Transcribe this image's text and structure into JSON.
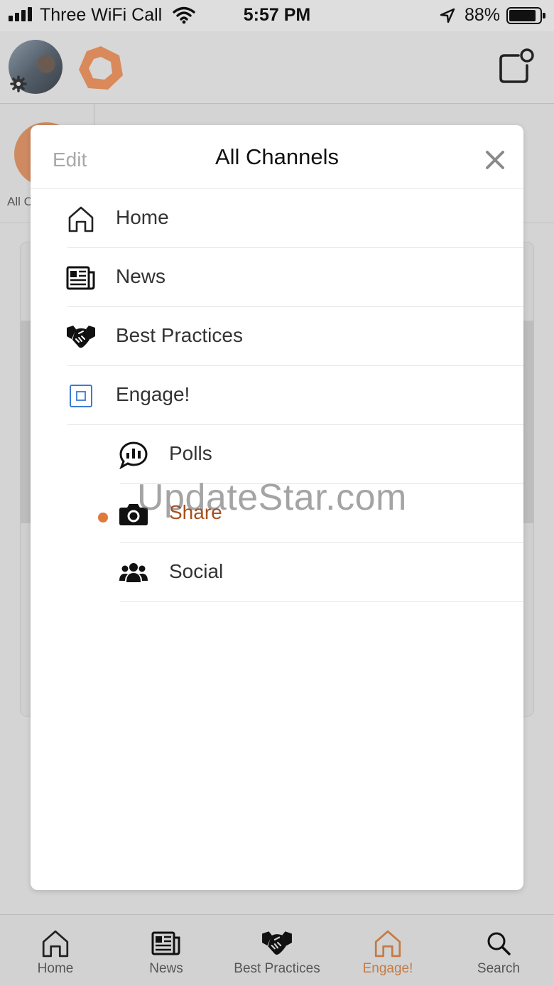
{
  "status_bar": {
    "carrier": "Three WiFi Call",
    "time": "5:57 PM",
    "battery_percent": "88%",
    "battery_level": 0.88,
    "icons": [
      "signal-bars-icon",
      "wifi-icon",
      "location-arrow-icon",
      "battery-icon"
    ]
  },
  "header": {
    "avatar": "user-avatar",
    "icons": [
      "settings-gear-icon",
      "brand-logo-icon",
      "compose-notification-icon"
    ]
  },
  "background": {
    "channel_strip_label": "All C"
  },
  "modal": {
    "edit_label": "Edit",
    "title": "All Channels",
    "close_icon": "close-x-icon",
    "channels": [
      {
        "label": "Home",
        "icon": "home-icon",
        "level": 0
      },
      {
        "label": "News",
        "icon": "newspaper-icon",
        "level": 0
      },
      {
        "label": "Best Practices",
        "icon": "handshake-icon",
        "level": 0
      },
      {
        "label": "Engage!",
        "icon": "engage-square-icon",
        "level": 0
      },
      {
        "label": "Polls",
        "icon": "poll-chat-icon",
        "level": 1
      },
      {
        "label": "Share",
        "icon": "camera-icon",
        "level": 1,
        "active": true
      },
      {
        "label": "Social",
        "icon": "people-group-icon",
        "level": 1
      }
    ],
    "active_color": "#a6501e",
    "dot_color": "#e07a3c"
  },
  "watermark": "UpdateStar.com",
  "tab_bar": {
    "tabs": [
      {
        "label": "Home",
        "icon": "home-icon"
      },
      {
        "label": "News",
        "icon": "newspaper-icon"
      },
      {
        "label": "Best Practices",
        "icon": "handshake-icon"
      },
      {
        "label": "Engage!",
        "icon": "home-outline-icon",
        "active": true
      },
      {
        "label": "Search",
        "icon": "search-icon"
      }
    ],
    "active_color": "#c57a46"
  }
}
